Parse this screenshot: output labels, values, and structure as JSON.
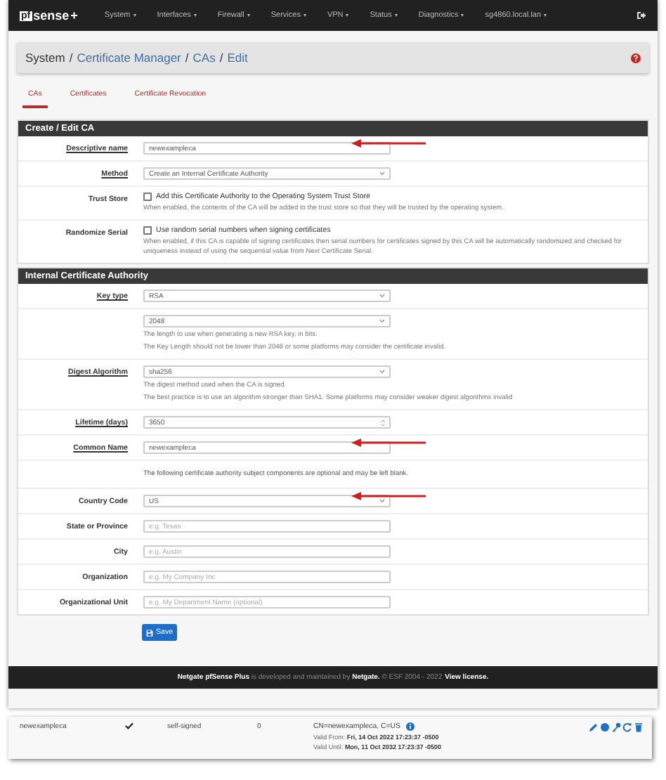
{
  "navbar": {
    "logo": {
      "box": "pf",
      "text": "sense",
      "plus": "+"
    },
    "items": [
      {
        "label": "System"
      },
      {
        "label": "Interfaces"
      },
      {
        "label": "Firewall"
      },
      {
        "label": "Services"
      },
      {
        "label": "VPN"
      },
      {
        "label": "Status"
      },
      {
        "label": "Diagnostics"
      },
      {
        "label": "sg4860.local.lan"
      }
    ]
  },
  "breadcrumb": [
    {
      "label": "System",
      "link": false
    },
    {
      "label": "Certificate Manager",
      "link": true
    },
    {
      "label": "CAs",
      "link": true
    },
    {
      "label": "Edit",
      "link": true
    }
  ],
  "breadcrumb_separator": "/",
  "tabs": [
    {
      "label": "CAs",
      "selected": true
    },
    {
      "label": "Certificates",
      "selected": false
    },
    {
      "label": "Certificate Revocation",
      "selected": false
    }
  ],
  "sections": [
    {
      "title": "Create / Edit CA",
      "rows": [
        {
          "kind": "input",
          "label": "Descriptive name",
          "required": true,
          "value": "newexampleca",
          "arrow": true
        },
        {
          "kind": "select",
          "label": "Method",
          "required": true,
          "value": "Create an Internal Certificate Authority"
        },
        {
          "kind": "checkbox",
          "label": "Trust Store",
          "required": false,
          "checked": false,
          "text": "Add this Certificate Authority to the Operating System Trust Store",
          "help": [
            "When enabled, the contents of the CA will be added to the trust store so that they will be trusted by the operating system."
          ]
        },
        {
          "kind": "checkbox",
          "label": "Randomize Serial",
          "required": false,
          "checked": false,
          "text": "Use random serial numbers when signing certificates",
          "help": [
            "When enabled, if this CA is capable of signing certificates then serial numbers for certificates signed by this CA will be automatically randomized and checked for uniqueness instead of using the sequential value from Next Certificate Serial."
          ]
        }
      ]
    },
    {
      "title": "Internal Certificate Authority",
      "rows": [
        {
          "kind": "select",
          "label": "Key type",
          "required": true,
          "value": "RSA"
        },
        {
          "kind": "select",
          "value": "2048",
          "help": [
            "The length to use when generating a new RSA key, in bits.",
            "The Key Length should not be lower than 2048 or some platforms may consider the certificate invalid."
          ]
        },
        {
          "kind": "select",
          "label": "Digest Algorithm",
          "required": true,
          "value": "sha256",
          "help": [
            "The digest method used when the CA is signed.",
            "The best practice is to use an algorithm stronger than SHA1. Some platforms may consider weaker digest algorithms invalid"
          ]
        },
        {
          "kind": "number",
          "label": "Lifetime (days)",
          "required": true,
          "value": "3650"
        },
        {
          "kind": "input",
          "label": "Common Name",
          "required": true,
          "value": "newexampleca",
          "arrow": true
        },
        {
          "kind": "note",
          "text": "The following certificate authority subject components are optional and may be left blank."
        },
        {
          "kind": "select",
          "label": "Country Code",
          "required": false,
          "value": "US",
          "arrow": true
        },
        {
          "kind": "input",
          "label": "State or Province",
          "required": false,
          "placeholder": "e.g. Texas"
        },
        {
          "kind": "input",
          "label": "City",
          "required": false,
          "placeholder": "e.g. Austin"
        },
        {
          "kind": "input",
          "label": "Organization",
          "required": false,
          "placeholder": "e.g. My Company Inc"
        },
        {
          "kind": "input",
          "label": "Organizational Unit",
          "required": false,
          "placeholder": "e.g. My Department Name (optional)"
        }
      ]
    }
  ],
  "save_button": "Save",
  "footer": {
    "text": "**Netgate pfSense Plus** is developed and maintained by **Netgate.** © ESF 2004 - 2022",
    "link": "View license."
  },
  "ca_row": {
    "name": "newexampleca",
    "internal": true,
    "issuer": "self-signed",
    "certificates": "0",
    "subject": "CN=newexampleca, C=US",
    "valid_from": "Valid From: **Fri, 14 Oct 2022 17:23:37 -0500**",
    "valid_until": "Valid Until: **Mon, 11 Oct 2032 17:23:37 -0500**"
  }
}
